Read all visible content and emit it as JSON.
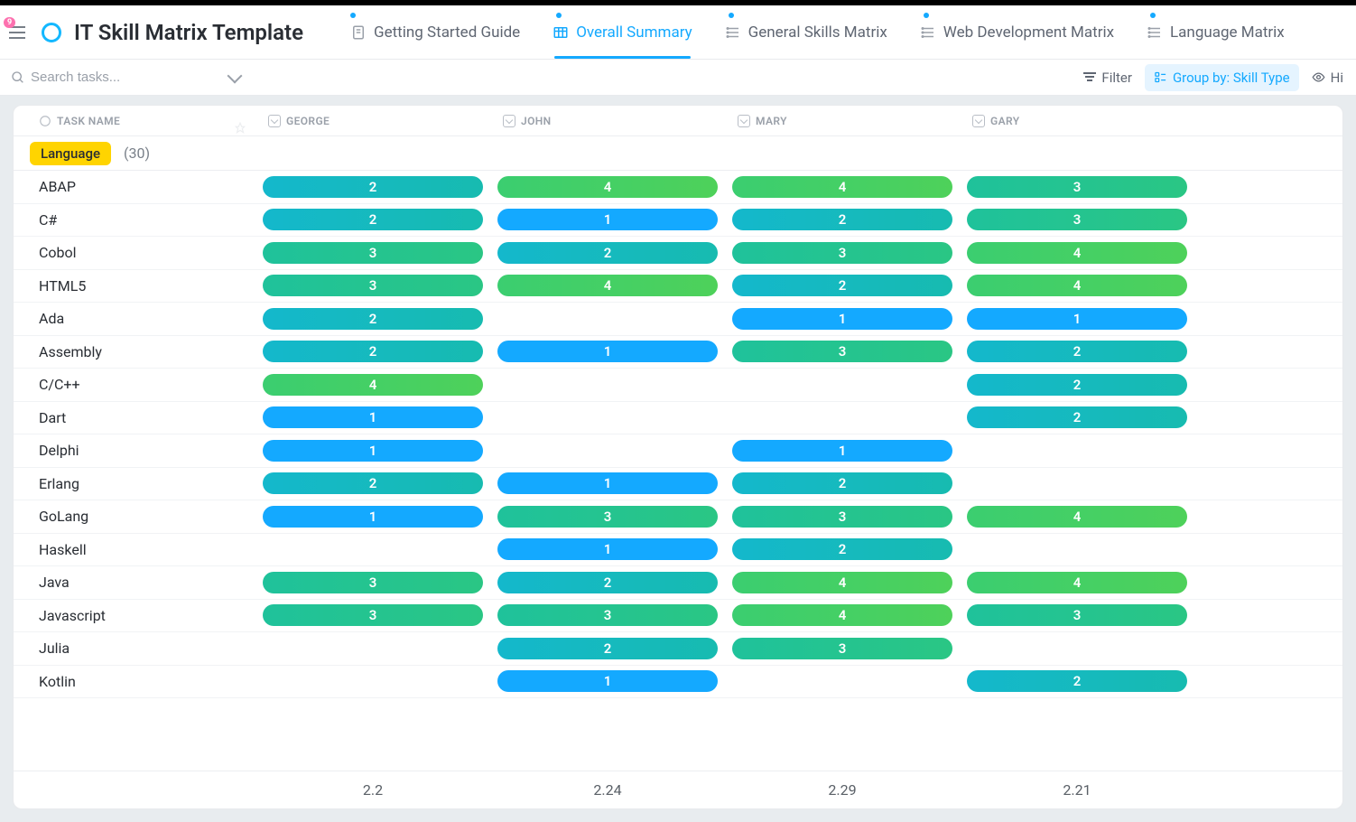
{
  "header": {
    "notif_count": "9",
    "title": "IT Skill Matrix Template",
    "tabs": [
      {
        "label": "Getting Started Guide",
        "active": false
      },
      {
        "label": "Overall Summary",
        "active": true
      },
      {
        "label": "General Skills Matrix",
        "active": false
      },
      {
        "label": "Web Development Matrix",
        "active": false
      },
      {
        "label": "Language Matrix",
        "active": false
      }
    ]
  },
  "toolbar": {
    "search_placeholder": "Search tasks...",
    "filter_label": "Filter",
    "group_label": "Group by: Skill Type",
    "hide_label": "Hi"
  },
  "columns": {
    "name_label": "TASK NAME",
    "persons": [
      "GEORGE",
      "JOHN",
      "MARY",
      "GARY"
    ]
  },
  "group": {
    "tag": "Language",
    "count": "(30)"
  },
  "rows": [
    {
      "name": "ABAP",
      "vals": [
        2,
        4,
        4,
        3
      ]
    },
    {
      "name": "C#",
      "vals": [
        2,
        1,
        2,
        3
      ]
    },
    {
      "name": "Cobol",
      "vals": [
        3,
        2,
        3,
        4
      ]
    },
    {
      "name": "HTML5",
      "vals": [
        3,
        4,
        2,
        4
      ]
    },
    {
      "name": "Ada",
      "vals": [
        2,
        null,
        1,
        1
      ]
    },
    {
      "name": "Assembly",
      "vals": [
        2,
        1,
        3,
        2
      ]
    },
    {
      "name": "C/C++",
      "vals": [
        4,
        null,
        null,
        2
      ]
    },
    {
      "name": "Dart",
      "vals": [
        1,
        null,
        null,
        2
      ]
    },
    {
      "name": "Delphi",
      "vals": [
        1,
        null,
        1,
        null
      ]
    },
    {
      "name": "Erlang",
      "vals": [
        2,
        1,
        2,
        null
      ]
    },
    {
      "name": "GoLang",
      "vals": [
        1,
        3,
        3,
        4
      ]
    },
    {
      "name": "Haskell",
      "vals": [
        null,
        1,
        2,
        null
      ]
    },
    {
      "name": "Java",
      "vals": [
        3,
        2,
        4,
        4
      ]
    },
    {
      "name": "Javascript",
      "vals": [
        3,
        3,
        4,
        3
      ]
    },
    {
      "name": "Julia",
      "vals": [
        null,
        2,
        3,
        null
      ]
    },
    {
      "name": "Kotlin",
      "vals": [
        null,
        1,
        null,
        2
      ]
    }
  ],
  "footer": [
    "2.2",
    "2.24",
    "2.29",
    "2.21"
  ],
  "chart_data": {
    "type": "table",
    "title": "IT Skill Matrix — Language skill levels (1–4) per person",
    "columns": [
      "GEORGE",
      "JOHN",
      "MARY",
      "GARY"
    ],
    "rows": [
      "ABAP",
      "C#",
      "Cobol",
      "HTML5",
      "Ada",
      "Assembly",
      "C/C++",
      "Dart",
      "Delphi",
      "Erlang",
      "GoLang",
      "Haskell",
      "Java",
      "Javascript",
      "Julia",
      "Kotlin"
    ],
    "values": [
      [
        2,
        4,
        4,
        3
      ],
      [
        2,
        1,
        2,
        3
      ],
      [
        3,
        2,
        3,
        4
      ],
      [
        3,
        4,
        2,
        4
      ],
      [
        2,
        null,
        1,
        1
      ],
      [
        2,
        1,
        3,
        2
      ],
      [
        4,
        null,
        null,
        2
      ],
      [
        1,
        null,
        null,
        2
      ],
      [
        1,
        null,
        1,
        null
      ],
      [
        2,
        1,
        2,
        null
      ],
      [
        1,
        3,
        3,
        4
      ],
      [
        null,
        1,
        2,
        null
      ],
      [
        3,
        2,
        4,
        4
      ],
      [
        3,
        3,
        4,
        3
      ],
      [
        null,
        2,
        3,
        null
      ],
      [
        null,
        1,
        null,
        2
      ]
    ],
    "column_means": [
      2.2,
      2.24,
      2.29,
      2.21
    ],
    "scale": {
      "min": 1,
      "max": 4
    }
  }
}
